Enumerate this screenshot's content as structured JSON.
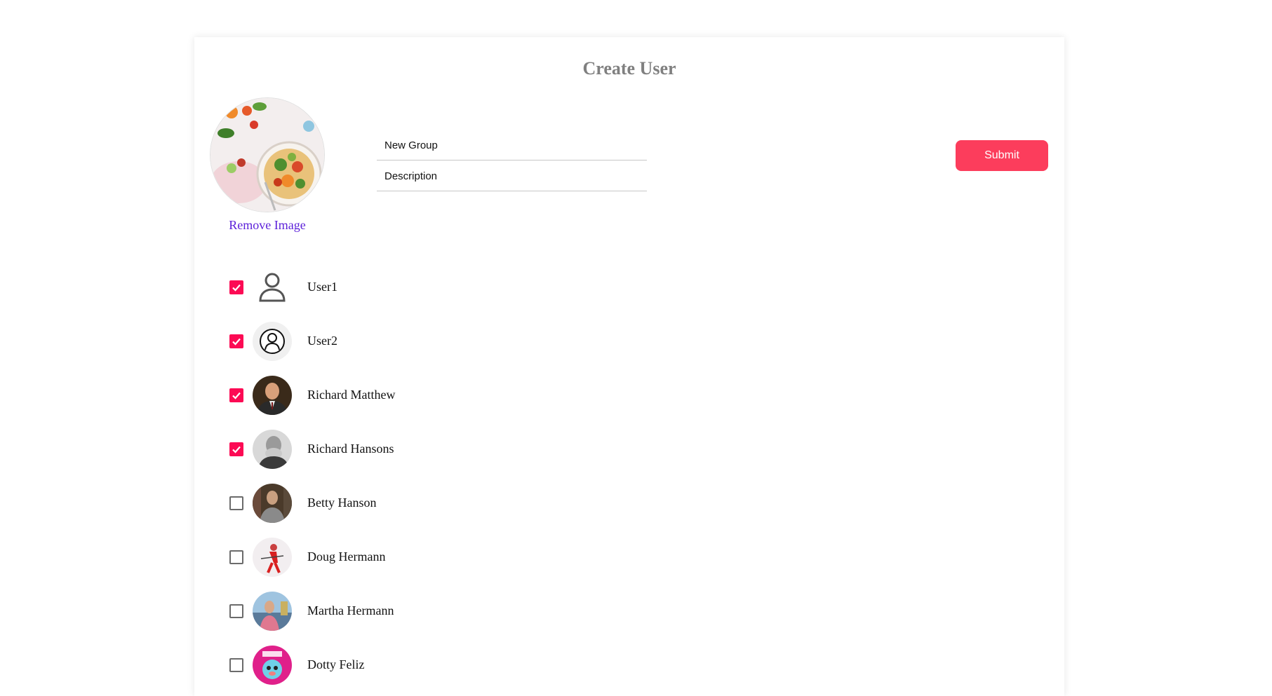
{
  "page": {
    "title": "Create User"
  },
  "group_image": {
    "icon": "salad-photo",
    "remove_label": "Remove Image"
  },
  "form": {
    "name_placeholder": "New Group",
    "description_placeholder": "Description",
    "submit_label": "Submit"
  },
  "colors": {
    "accent": "#fc3d5c",
    "checkbox_on": "#fc0a54",
    "link": "#5b1fd9",
    "title": "#808080"
  },
  "users": [
    {
      "name": "User1",
      "checked": true,
      "avatar": "person-outline-icon"
    },
    {
      "name": "User2",
      "checked": true,
      "avatar": "person-circle-icon"
    },
    {
      "name": "Richard Matthew",
      "checked": true,
      "avatar": "photo-man-suit"
    },
    {
      "name": "Richard Hansons",
      "checked": true,
      "avatar": "photo-bw-portrait"
    },
    {
      "name": "Betty Hanson",
      "checked": false,
      "avatar": "photo-woman-library"
    },
    {
      "name": "Doug Hermann",
      "checked": false,
      "avatar": "photo-skier"
    },
    {
      "name": "Martha Hermann",
      "checked": false,
      "avatar": "photo-woman-harbor"
    },
    {
      "name": "Dotty Feliz",
      "checked": false,
      "avatar": "photo-dotty-cartoon"
    }
  ]
}
